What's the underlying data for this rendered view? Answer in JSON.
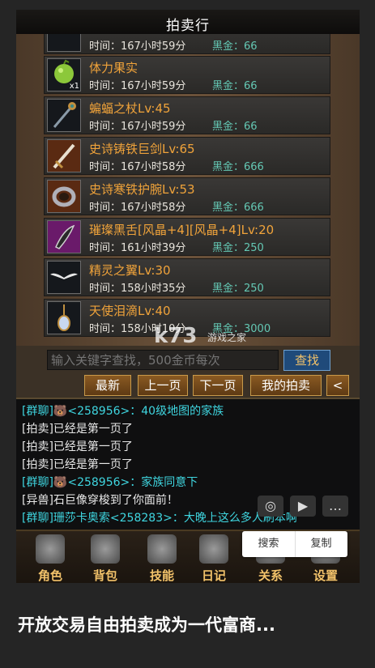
{
  "header": {
    "title": "拍卖行"
  },
  "items": [
    {
      "name": "体力果实",
      "time": "时间：167小时59分",
      "price": "黑金：66",
      "qty": "x1",
      "icon": "green-fruit-icon"
    },
    {
      "name": "蝙蝠之杖Lv:45",
      "time": "时间：167小时59分",
      "price": "黑金：66",
      "icon": "staff-icon"
    },
    {
      "name": "史诗铸铁巨剑Lv:65",
      "time": "时间：167小时58分",
      "price": "黑金：666",
      "icon": "sword-icon"
    },
    {
      "name": "史诗寒铁护腕Lv:53",
      "time": "时间：167小时58分",
      "price": "黑金：666",
      "icon": "bracer-icon"
    },
    {
      "name": "璀璨黑舌[风晶+4][风晶+4]Lv:20",
      "time": "时间：161小时39分",
      "price": "黑金：250",
      "icon": "blade-icon"
    },
    {
      "name": "精灵之翼Lv:30",
      "time": "时间：158小时35分",
      "price": "黑金：250",
      "icon": "wings-icon"
    },
    {
      "name": "天使泪滴Lv:40",
      "time": "时间：158小时10分",
      "price": "黑金：3000",
      "icon": "pendant-icon"
    }
  ],
  "partial_top": {
    "time": "时间：167小时59分",
    "price": "黑金：66"
  },
  "search": {
    "placeholder": "输入关键字查找，500金币每次",
    "button": "查找"
  },
  "pagination": {
    "newest": "最新",
    "prev": "上一页",
    "next": "下一页",
    "mine": "我的拍卖",
    "collapse": "<"
  },
  "chat": [
    {
      "text": "[群聊]🐻<258956>：40级地图的家族",
      "color": "cyan"
    },
    {
      "text": "[拍卖]已经是第一页了",
      "color": "white"
    },
    {
      "text": "[拍卖]已经是第一页了",
      "color": "white"
    },
    {
      "text": "[拍卖]已经是第一页了",
      "color": "white"
    },
    {
      "text": "[群聊]🐻<258956>：家族同意下",
      "color": "cyan"
    },
    {
      "text": "[异兽]石巨像穿梭到了你面前！",
      "color": "white"
    },
    {
      "text": "[群聊]珊莎卡奥索<258283>：大晚上这么多人刷本啊",
      "color": "cyan"
    }
  ],
  "nav": [
    {
      "label": "角色",
      "icon": "helmet-icon"
    },
    {
      "label": "背包",
      "icon": "bag-icon"
    },
    {
      "label": "技能",
      "icon": "skill-icon"
    },
    {
      "label": "日记",
      "icon": "scroll-icon"
    },
    {
      "label": "关系",
      "icon": "relation-icon"
    },
    {
      "label": "设置",
      "icon": "gear-icon"
    }
  ],
  "popup": {
    "search": "搜索",
    "copy": "复制"
  },
  "watermark": {
    "main": "k73",
    "sub": "游戏之家"
  },
  "caption": "开放交易自由拍卖成为一代富商..."
}
